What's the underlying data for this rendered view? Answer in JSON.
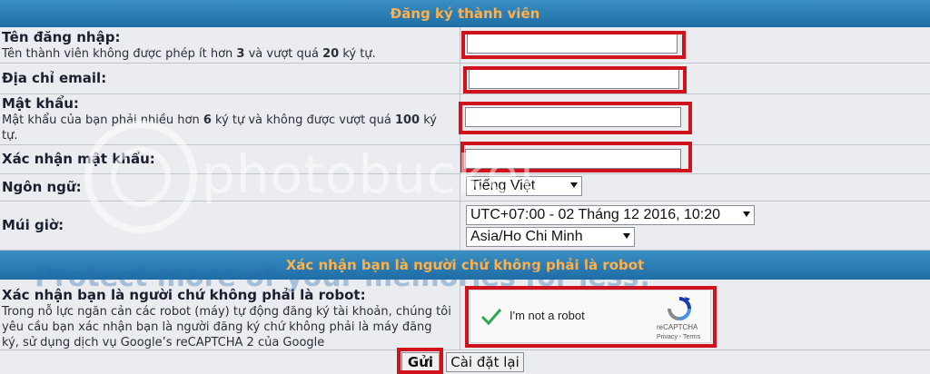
{
  "form": {
    "title": "Đăng ký thành viên",
    "username": {
      "label": "Tên đăng nhập:",
      "explain_pre": "Tên thành viên không được phép ít hơn ",
      "min": "3",
      "explain_mid": " và vượt quá ",
      "max": "20",
      "explain_post": " ký tự."
    },
    "email": {
      "label": "Địa chỉ email:"
    },
    "password": {
      "label": "Mật khẩu:",
      "explain_pre": "Mật khẩu của bạn phải nhiều hơn ",
      "min": "6",
      "explain_mid": " ký tự và không được vượt quá ",
      "max": "100",
      "explain_post": " ký tự."
    },
    "password_confirm": {
      "label": "Xác nhận mật khẩu:"
    },
    "language": {
      "label": "Ngôn ngữ:",
      "value": "Tiếng Việt"
    },
    "timezone": {
      "label": "Múi giờ:",
      "value": "UTC+07:00 - 02 Tháng 12 2016, 10:20",
      "region": "Asia/Ho Chi Minh"
    }
  },
  "captcha": {
    "title": "Xác nhận bạn là người chứ không phải là robot",
    "label": "Xác nhận bạn là người chứ không phải là robot:",
    "explain": "Trong nỗ lực ngăn cản các robot (máy) tự động đăng ký tài khoản, chúng tôi yêu cầu bạn xác nhận bạn là người đăng ký chứ không phải là máy đăng ký, sử dụng dịch vụ Google’s reCAPTCHA 2 của Google",
    "checkbox_text": "I'm not a robot",
    "brand": "reCAPTCHA",
    "links": "Privacy - Terms"
  },
  "buttons": {
    "submit": "Gửi",
    "reset": "Cài đặt lại"
  },
  "watermark": {
    "brand": "photobucket",
    "slogan": "Protect more of your memories for less!"
  },
  "colors": {
    "header": "#2b7fb8",
    "header_text": "#ffb04a",
    "highlight": "#d0121c",
    "row_bg": "#eaecef"
  }
}
